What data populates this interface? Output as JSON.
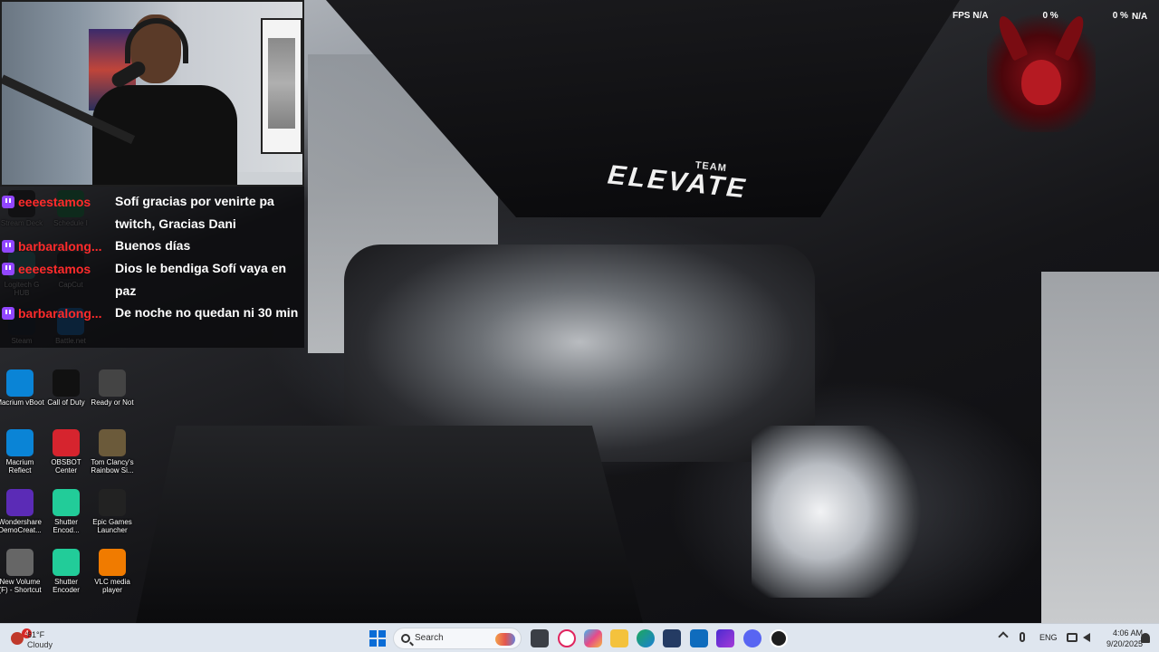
{
  "overlay": {
    "fps_label": "FPS",
    "fps_value": "N/A",
    "cpu_value": "0 %",
    "gpu_value": "0 %",
    "right_value": "N/A"
  },
  "banner": {
    "team": "TEAM",
    "name": "ELEVATE"
  },
  "chat": {
    "messages": [
      {
        "user": "eeeestamos",
        "text": "Sofí gracias por venirte pa twitch, Gracias Dani"
      },
      {
        "user": "barbaralong...",
        "text": "Buenos días"
      },
      {
        "user": "eeeestamos",
        "text": "Dios le bendiga Sofí vaya en paz"
      },
      {
        "user": "barbaralong...",
        "text": "De noche no quedan ni 30 min"
      }
    ],
    "colors": {
      "username": "#ff2b2b",
      "platform": "#9146ff"
    }
  },
  "desktop": {
    "icons": [
      {
        "label": "Stream Deck",
        "icon": "stream-deck-icon"
      },
      {
        "label": "Schedule I",
        "icon": "schedule-icon"
      },
      {
        "label": "Logitech G HUB",
        "icon": "logitech-icon"
      },
      {
        "label": "CapCut",
        "icon": "capcut-icon"
      },
      {
        "label": "Steam",
        "icon": "steam-icon"
      },
      {
        "label": "Battle.net",
        "icon": "battlenet-icon"
      },
      {
        "label": "Macrium vBoot",
        "icon": "macrium-vboot-icon"
      },
      {
        "label": "Call of Duty",
        "icon": "call-of-duty-icon"
      },
      {
        "label": "Ready or Not",
        "icon": "ready-or-not-icon"
      },
      {
        "label": "Macrium Reflect",
        "icon": "macrium-reflect-icon"
      },
      {
        "label": "OBSBOT Center",
        "icon": "obsbot-icon"
      },
      {
        "label": "Tom Clancy's Rainbow Si...",
        "icon": "rainbow-six-icon"
      },
      {
        "label": "Wondershare DemoCreat...",
        "icon": "wondershare-icon"
      },
      {
        "label": "Shutter Encod...",
        "icon": "shutter-encoder-icon"
      },
      {
        "label": "Epic Games Launcher",
        "icon": "epic-games-icon"
      },
      {
        "label": "New Volume (F) - Shortcut",
        "icon": "drive-icon"
      },
      {
        "label": "Shutter Encoder",
        "icon": "shutter-encoder-icon"
      },
      {
        "label": "VLC media player",
        "icon": "vlc-icon"
      }
    ]
  },
  "taskbar": {
    "weather_temp": "61°F",
    "weather_cond": "Cloudy",
    "weather_badge": "4",
    "search_placeholder": "Search",
    "language": "ENG",
    "time": "4:06 AM",
    "date": "9/20/2025"
  }
}
